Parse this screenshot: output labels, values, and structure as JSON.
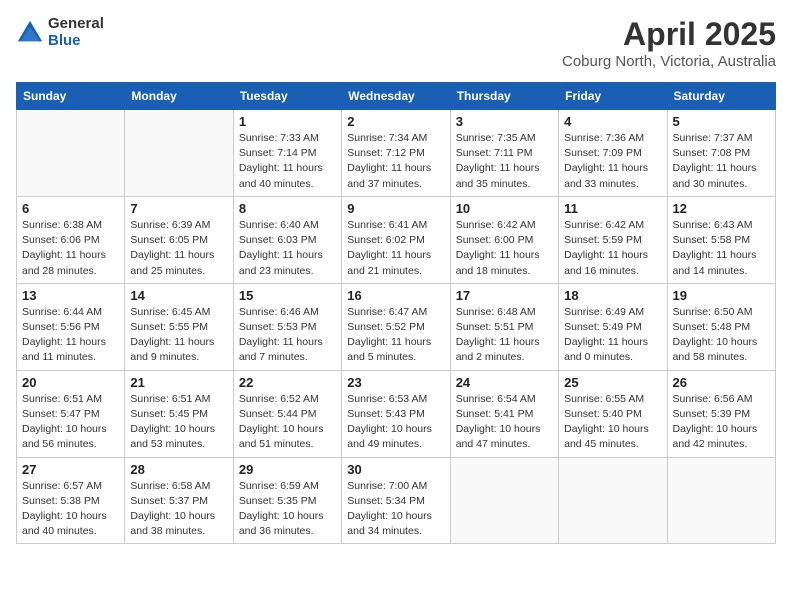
{
  "logo": {
    "general": "General",
    "blue": "Blue"
  },
  "title": "April 2025",
  "subtitle": "Coburg North, Victoria, Australia",
  "headers": [
    "Sunday",
    "Monday",
    "Tuesday",
    "Wednesday",
    "Thursday",
    "Friday",
    "Saturday"
  ],
  "weeks": [
    [
      {
        "day": "",
        "sunrise": "",
        "sunset": "",
        "daylight": ""
      },
      {
        "day": "",
        "sunrise": "",
        "sunset": "",
        "daylight": ""
      },
      {
        "day": "1",
        "sunrise": "Sunrise: 7:33 AM",
        "sunset": "Sunset: 7:14 PM",
        "daylight": "Daylight: 11 hours and 40 minutes."
      },
      {
        "day": "2",
        "sunrise": "Sunrise: 7:34 AM",
        "sunset": "Sunset: 7:12 PM",
        "daylight": "Daylight: 11 hours and 37 minutes."
      },
      {
        "day": "3",
        "sunrise": "Sunrise: 7:35 AM",
        "sunset": "Sunset: 7:11 PM",
        "daylight": "Daylight: 11 hours and 35 minutes."
      },
      {
        "day": "4",
        "sunrise": "Sunrise: 7:36 AM",
        "sunset": "Sunset: 7:09 PM",
        "daylight": "Daylight: 11 hours and 33 minutes."
      },
      {
        "day": "5",
        "sunrise": "Sunrise: 7:37 AM",
        "sunset": "Sunset: 7:08 PM",
        "daylight": "Daylight: 11 hours and 30 minutes."
      }
    ],
    [
      {
        "day": "6",
        "sunrise": "Sunrise: 6:38 AM",
        "sunset": "Sunset: 6:06 PM",
        "daylight": "Daylight: 11 hours and 28 minutes."
      },
      {
        "day": "7",
        "sunrise": "Sunrise: 6:39 AM",
        "sunset": "Sunset: 6:05 PM",
        "daylight": "Daylight: 11 hours and 25 minutes."
      },
      {
        "day": "8",
        "sunrise": "Sunrise: 6:40 AM",
        "sunset": "Sunset: 6:03 PM",
        "daylight": "Daylight: 11 hours and 23 minutes."
      },
      {
        "day": "9",
        "sunrise": "Sunrise: 6:41 AM",
        "sunset": "Sunset: 6:02 PM",
        "daylight": "Daylight: 11 hours and 21 minutes."
      },
      {
        "day": "10",
        "sunrise": "Sunrise: 6:42 AM",
        "sunset": "Sunset: 6:00 PM",
        "daylight": "Daylight: 11 hours and 18 minutes."
      },
      {
        "day": "11",
        "sunrise": "Sunrise: 6:42 AM",
        "sunset": "Sunset: 5:59 PM",
        "daylight": "Daylight: 11 hours and 16 minutes."
      },
      {
        "day": "12",
        "sunrise": "Sunrise: 6:43 AM",
        "sunset": "Sunset: 5:58 PM",
        "daylight": "Daylight: 11 hours and 14 minutes."
      }
    ],
    [
      {
        "day": "13",
        "sunrise": "Sunrise: 6:44 AM",
        "sunset": "Sunset: 5:56 PM",
        "daylight": "Daylight: 11 hours and 11 minutes."
      },
      {
        "day": "14",
        "sunrise": "Sunrise: 6:45 AM",
        "sunset": "Sunset: 5:55 PM",
        "daylight": "Daylight: 11 hours and 9 minutes."
      },
      {
        "day": "15",
        "sunrise": "Sunrise: 6:46 AM",
        "sunset": "Sunset: 5:53 PM",
        "daylight": "Daylight: 11 hours and 7 minutes."
      },
      {
        "day": "16",
        "sunrise": "Sunrise: 6:47 AM",
        "sunset": "Sunset: 5:52 PM",
        "daylight": "Daylight: 11 hours and 5 minutes."
      },
      {
        "day": "17",
        "sunrise": "Sunrise: 6:48 AM",
        "sunset": "Sunset: 5:51 PM",
        "daylight": "Daylight: 11 hours and 2 minutes."
      },
      {
        "day": "18",
        "sunrise": "Sunrise: 6:49 AM",
        "sunset": "Sunset: 5:49 PM",
        "daylight": "Daylight: 11 hours and 0 minutes."
      },
      {
        "day": "19",
        "sunrise": "Sunrise: 6:50 AM",
        "sunset": "Sunset: 5:48 PM",
        "daylight": "Daylight: 10 hours and 58 minutes."
      }
    ],
    [
      {
        "day": "20",
        "sunrise": "Sunrise: 6:51 AM",
        "sunset": "Sunset: 5:47 PM",
        "daylight": "Daylight: 10 hours and 56 minutes."
      },
      {
        "day": "21",
        "sunrise": "Sunrise: 6:51 AM",
        "sunset": "Sunset: 5:45 PM",
        "daylight": "Daylight: 10 hours and 53 minutes."
      },
      {
        "day": "22",
        "sunrise": "Sunrise: 6:52 AM",
        "sunset": "Sunset: 5:44 PM",
        "daylight": "Daylight: 10 hours and 51 minutes."
      },
      {
        "day": "23",
        "sunrise": "Sunrise: 6:53 AM",
        "sunset": "Sunset: 5:43 PM",
        "daylight": "Daylight: 10 hours and 49 minutes."
      },
      {
        "day": "24",
        "sunrise": "Sunrise: 6:54 AM",
        "sunset": "Sunset: 5:41 PM",
        "daylight": "Daylight: 10 hours and 47 minutes."
      },
      {
        "day": "25",
        "sunrise": "Sunrise: 6:55 AM",
        "sunset": "Sunset: 5:40 PM",
        "daylight": "Daylight: 10 hours and 45 minutes."
      },
      {
        "day": "26",
        "sunrise": "Sunrise: 6:56 AM",
        "sunset": "Sunset: 5:39 PM",
        "daylight": "Daylight: 10 hours and 42 minutes."
      }
    ],
    [
      {
        "day": "27",
        "sunrise": "Sunrise: 6:57 AM",
        "sunset": "Sunset: 5:38 PM",
        "daylight": "Daylight: 10 hours and 40 minutes."
      },
      {
        "day": "28",
        "sunrise": "Sunrise: 6:58 AM",
        "sunset": "Sunset: 5:37 PM",
        "daylight": "Daylight: 10 hours and 38 minutes."
      },
      {
        "day": "29",
        "sunrise": "Sunrise: 6:59 AM",
        "sunset": "Sunset: 5:35 PM",
        "daylight": "Daylight: 10 hours and 36 minutes."
      },
      {
        "day": "30",
        "sunrise": "Sunrise: 7:00 AM",
        "sunset": "Sunset: 5:34 PM",
        "daylight": "Daylight: 10 hours and 34 minutes."
      },
      {
        "day": "",
        "sunrise": "",
        "sunset": "",
        "daylight": ""
      },
      {
        "day": "",
        "sunrise": "",
        "sunset": "",
        "daylight": ""
      },
      {
        "day": "",
        "sunrise": "",
        "sunset": "",
        "daylight": ""
      }
    ]
  ]
}
